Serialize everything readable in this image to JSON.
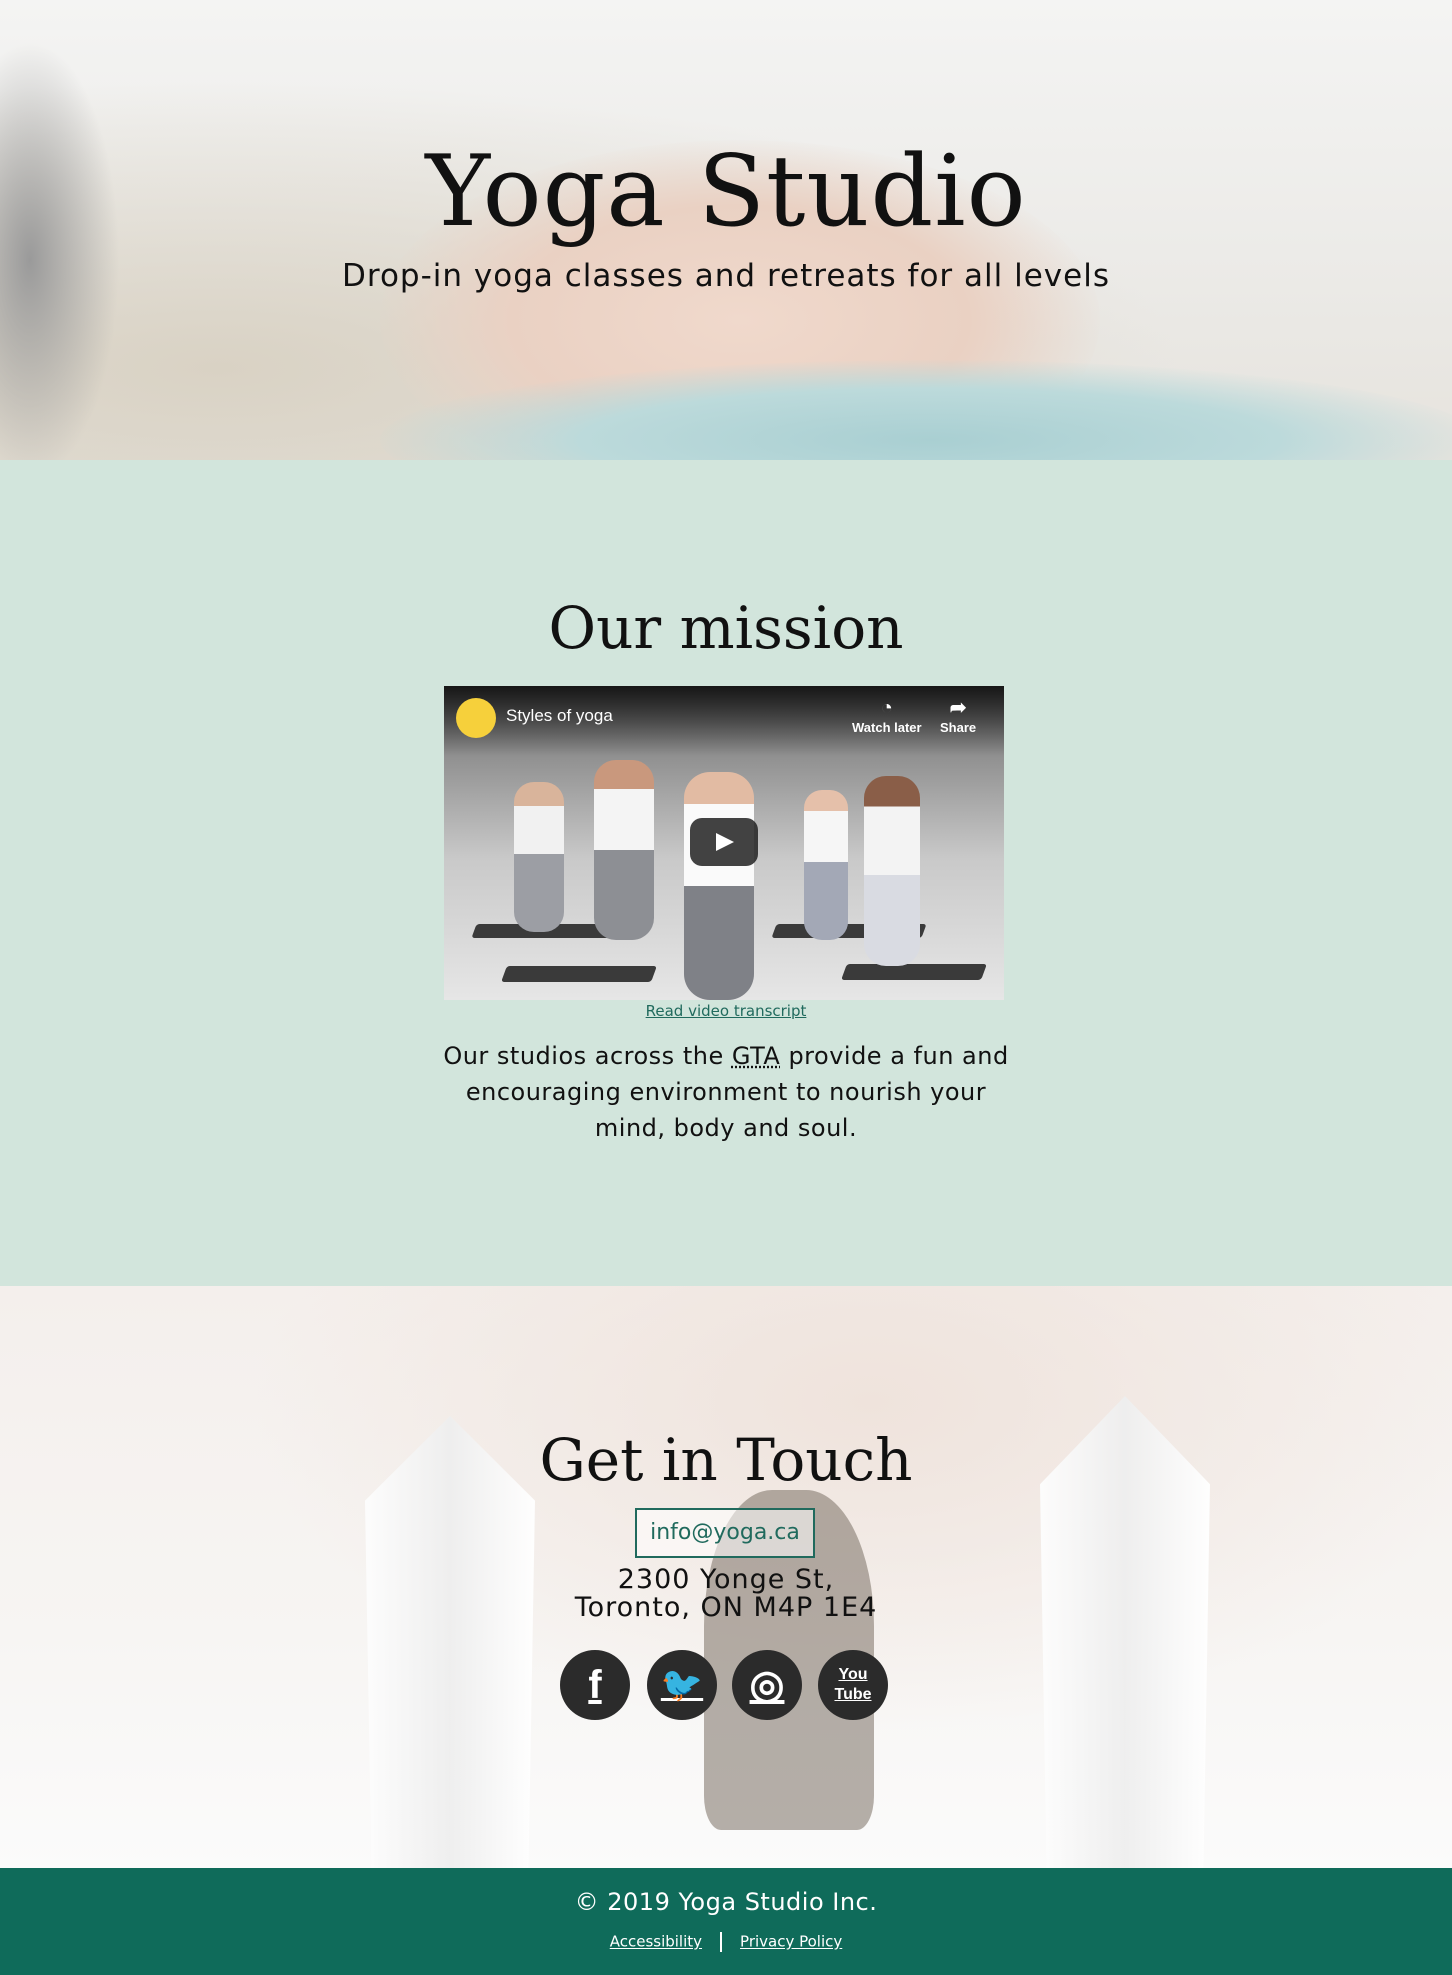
{
  "hero": {
    "title": "Yoga Studio",
    "subtitle": "Drop-in yoga classes and retreats for all levels"
  },
  "mission": {
    "title": "Our mission",
    "video": {
      "title": "Styles of yoga",
      "watch_later": "Watch later",
      "share": "Share"
    },
    "transcript_link": "Read video transcript",
    "text_before": "Our studios across the ",
    "abbr": "GTA",
    "text_after": " provide a fun and encouraging environment to nourish your mind, body and soul."
  },
  "contact": {
    "title": "Get in Touch",
    "email": "info@yoga.ca",
    "address_line1": "2300 Yonge St,",
    "address_line2": "Toronto, ON M4P 1E4",
    "social": [
      {
        "name": "facebook-icon",
        "glyph": "f"
      },
      {
        "name": "twitter-icon",
        "glyph": "🐦"
      },
      {
        "name": "instagram-icon",
        "glyph": "◎"
      },
      {
        "name": "youtube-icon",
        "glyph": "You Tube"
      }
    ]
  },
  "footer": {
    "copyright": "© 2019 Yoga Studio Inc.",
    "accessibility": "Accessibility",
    "privacy": "Privacy Policy"
  },
  "colors": {
    "mission_bg": "#d2e5dc",
    "accent": "#206a5d",
    "footer_bg": "#0f6b5a"
  }
}
